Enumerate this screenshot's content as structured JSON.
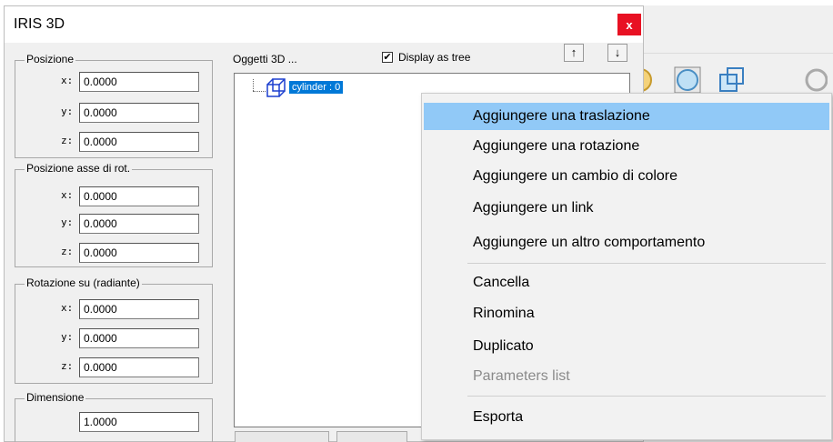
{
  "dialog": {
    "title": "IRIS 3D",
    "close_symbol": "x"
  },
  "groups": {
    "posizione": {
      "legend": "Posizione",
      "rows": [
        {
          "axis": "x:",
          "value": "0.0000"
        },
        {
          "axis": "y:",
          "value": "0.0000"
        },
        {
          "axis": "z:",
          "value": "0.0000"
        }
      ]
    },
    "asse": {
      "legend": "Posizione asse di rot.",
      "rows": [
        {
          "axis": "x:",
          "value": "0.0000"
        },
        {
          "axis": "y:",
          "value": "0.0000"
        },
        {
          "axis": "z:",
          "value": "0.0000"
        }
      ]
    },
    "rotazione": {
      "legend": "Rotazione su (radiante)",
      "rows": [
        {
          "axis": "x:",
          "value": "0.0000"
        },
        {
          "axis": "y:",
          "value": "0.0000"
        },
        {
          "axis": "z:",
          "value": "0.0000"
        }
      ]
    },
    "dimensione": {
      "legend": "Dimensione",
      "value": "1.0000"
    }
  },
  "objects": {
    "label": "Oggetti 3D ...",
    "display_tree_label": "Display as tree",
    "display_tree_checked": "✔",
    "up_arrow": "↑",
    "down_arrow": "↓",
    "tree_items": [
      {
        "label": "cylinder : 0",
        "icon": "cube-icon"
      }
    ]
  },
  "context_menu": {
    "items": [
      {
        "label": "Aggiungere una traslazione",
        "state": "hover"
      },
      {
        "label": "Aggiungere una rotazione",
        "state": "normal"
      },
      {
        "label": "Aggiungere un cambio di colore",
        "state": "normal"
      },
      {
        "label": "Aggiungere un link",
        "state": "normal"
      },
      {
        "label": "Aggiungere un altro comportamento",
        "state": "normal"
      },
      {
        "label": "Cancella",
        "state": "normal"
      },
      {
        "label": "Rinomina",
        "state": "normal"
      },
      {
        "label": "Duplicato",
        "state": "normal"
      },
      {
        "label": "Parameters list",
        "state": "disabled"
      },
      {
        "label": "Esporta",
        "state": "normal"
      }
    ]
  },
  "colors": {
    "selection": "#0078d7",
    "menu_hover": "#91c9f7",
    "close_button": "#e81123"
  }
}
